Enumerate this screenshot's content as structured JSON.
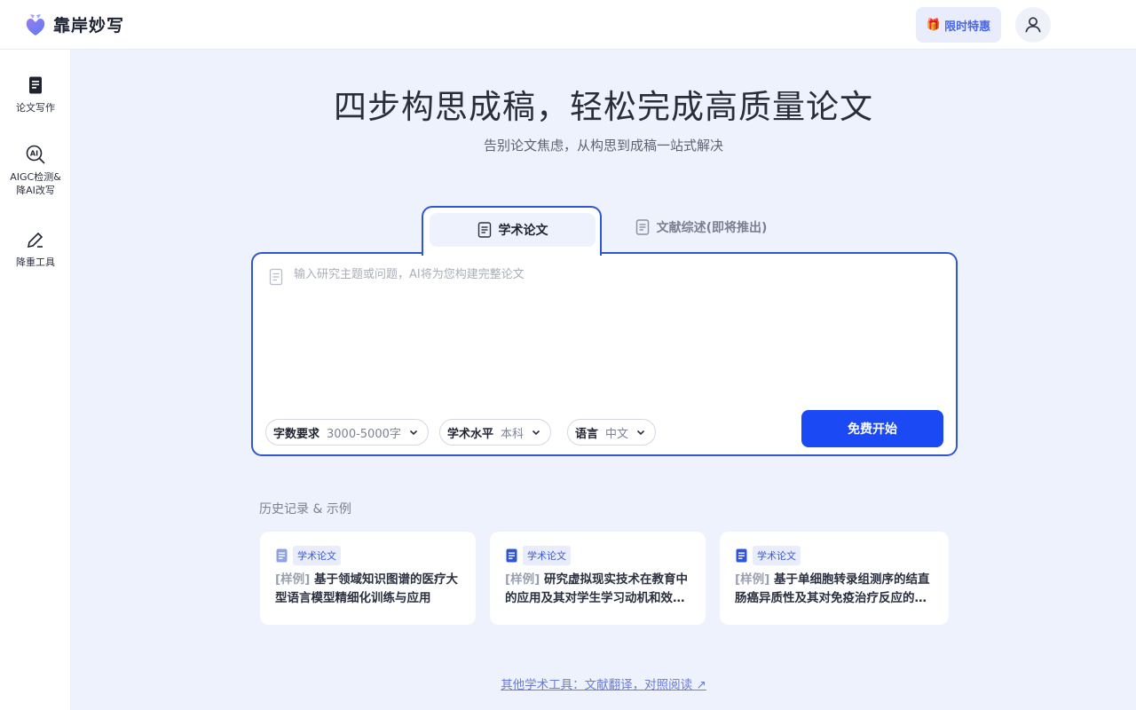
{
  "app": {
    "name": "靠岸妙写"
  },
  "header": {
    "promo_label": "限时特惠",
    "promo_icon": "🎁"
  },
  "sidebar": {
    "items": [
      {
        "label": "论文写作",
        "icon": "document-icon"
      },
      {
        "label": "AIGC检测&",
        "label2": "降AI改写",
        "icon": "ai-search-icon"
      },
      {
        "label": "降重工具",
        "icon": "pen-icon"
      }
    ]
  },
  "hero": {
    "title": "四步构思成稿，轻松完成高质量论文",
    "subtitle": "告别论文焦虑，从构思到成稿一站式解决"
  },
  "tabs": [
    {
      "label": "学术论文",
      "active": true
    },
    {
      "label": "文献综述(即将推出)",
      "active": false
    }
  ],
  "input": {
    "placeholder": "输入研究主题或问题，AI将为您构建完整论文",
    "value": ""
  },
  "options": [
    {
      "key": "字数要求",
      "value": "3000-5000字"
    },
    {
      "key": "学术水平",
      "value": "本科"
    },
    {
      "key": "语言",
      "value": "中文"
    }
  ],
  "start_button": "免费开始",
  "history": {
    "title": "历史记录 & 示例",
    "items": [
      {
        "badge": "学术论文",
        "tag": "[样例]",
        "title": "基于领域知识图谱的医疗大型语言模型精细化训练与应用",
        "icon_color": "#8fa2e6"
      },
      {
        "badge": "学术论文",
        "tag": "[样例]",
        "title": "研究虚拟现实技术在教育中的应用及其对学生学习动机和效果的影响",
        "icon_color": "#2f56d6"
      },
      {
        "badge": "学术论文",
        "tag": "[样例]",
        "title": "基于单细胞转录组测序的结直肠癌异质性及其对免疫治疗反应的研究",
        "icon_color": "#2f56d6"
      }
    ]
  },
  "footer": {
    "link": "其他学术工具：文献翻译，对照阅读 ↗"
  },
  "colors": {
    "accent": "#2f56d6",
    "button": "#1b4af5",
    "background": "#eef2fc"
  }
}
